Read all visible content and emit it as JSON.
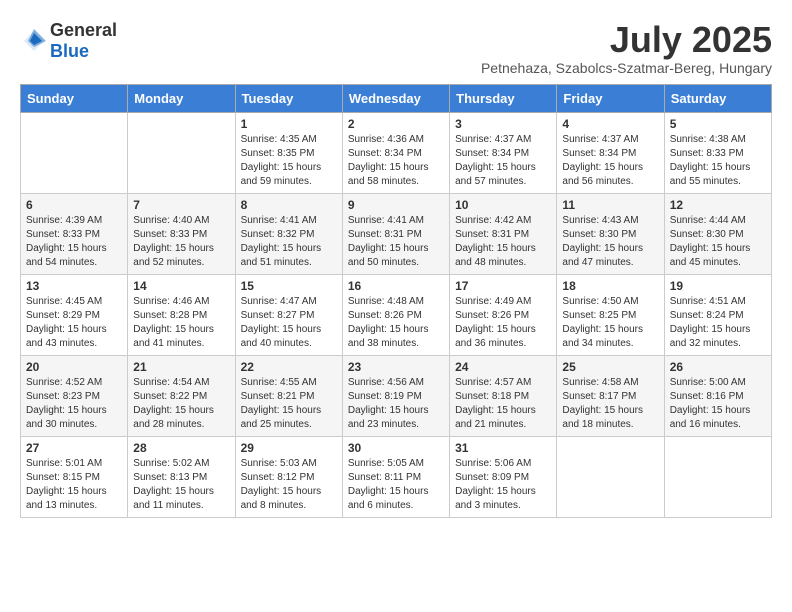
{
  "logo": {
    "general": "General",
    "blue": "Blue"
  },
  "title": "July 2025",
  "subtitle": "Petnehaza, Szabolcs-Szatmar-Bereg, Hungary",
  "days_of_week": [
    "Sunday",
    "Monday",
    "Tuesday",
    "Wednesday",
    "Thursday",
    "Friday",
    "Saturday"
  ],
  "weeks": [
    [
      {
        "day": "",
        "info": ""
      },
      {
        "day": "",
        "info": ""
      },
      {
        "day": "1",
        "info": "Sunrise: 4:35 AM\nSunset: 8:35 PM\nDaylight: 15 hours and 59 minutes."
      },
      {
        "day": "2",
        "info": "Sunrise: 4:36 AM\nSunset: 8:34 PM\nDaylight: 15 hours and 58 minutes."
      },
      {
        "day": "3",
        "info": "Sunrise: 4:37 AM\nSunset: 8:34 PM\nDaylight: 15 hours and 57 minutes."
      },
      {
        "day": "4",
        "info": "Sunrise: 4:37 AM\nSunset: 8:34 PM\nDaylight: 15 hours and 56 minutes."
      },
      {
        "day": "5",
        "info": "Sunrise: 4:38 AM\nSunset: 8:33 PM\nDaylight: 15 hours and 55 minutes."
      }
    ],
    [
      {
        "day": "6",
        "info": "Sunrise: 4:39 AM\nSunset: 8:33 PM\nDaylight: 15 hours and 54 minutes."
      },
      {
        "day": "7",
        "info": "Sunrise: 4:40 AM\nSunset: 8:33 PM\nDaylight: 15 hours and 52 minutes."
      },
      {
        "day": "8",
        "info": "Sunrise: 4:41 AM\nSunset: 8:32 PM\nDaylight: 15 hours and 51 minutes."
      },
      {
        "day": "9",
        "info": "Sunrise: 4:41 AM\nSunset: 8:31 PM\nDaylight: 15 hours and 50 minutes."
      },
      {
        "day": "10",
        "info": "Sunrise: 4:42 AM\nSunset: 8:31 PM\nDaylight: 15 hours and 48 minutes."
      },
      {
        "day": "11",
        "info": "Sunrise: 4:43 AM\nSunset: 8:30 PM\nDaylight: 15 hours and 47 minutes."
      },
      {
        "day": "12",
        "info": "Sunrise: 4:44 AM\nSunset: 8:30 PM\nDaylight: 15 hours and 45 minutes."
      }
    ],
    [
      {
        "day": "13",
        "info": "Sunrise: 4:45 AM\nSunset: 8:29 PM\nDaylight: 15 hours and 43 minutes."
      },
      {
        "day": "14",
        "info": "Sunrise: 4:46 AM\nSunset: 8:28 PM\nDaylight: 15 hours and 41 minutes."
      },
      {
        "day": "15",
        "info": "Sunrise: 4:47 AM\nSunset: 8:27 PM\nDaylight: 15 hours and 40 minutes."
      },
      {
        "day": "16",
        "info": "Sunrise: 4:48 AM\nSunset: 8:26 PM\nDaylight: 15 hours and 38 minutes."
      },
      {
        "day": "17",
        "info": "Sunrise: 4:49 AM\nSunset: 8:26 PM\nDaylight: 15 hours and 36 minutes."
      },
      {
        "day": "18",
        "info": "Sunrise: 4:50 AM\nSunset: 8:25 PM\nDaylight: 15 hours and 34 minutes."
      },
      {
        "day": "19",
        "info": "Sunrise: 4:51 AM\nSunset: 8:24 PM\nDaylight: 15 hours and 32 minutes."
      }
    ],
    [
      {
        "day": "20",
        "info": "Sunrise: 4:52 AM\nSunset: 8:23 PM\nDaylight: 15 hours and 30 minutes."
      },
      {
        "day": "21",
        "info": "Sunrise: 4:54 AM\nSunset: 8:22 PM\nDaylight: 15 hours and 28 minutes."
      },
      {
        "day": "22",
        "info": "Sunrise: 4:55 AM\nSunset: 8:21 PM\nDaylight: 15 hours and 25 minutes."
      },
      {
        "day": "23",
        "info": "Sunrise: 4:56 AM\nSunset: 8:19 PM\nDaylight: 15 hours and 23 minutes."
      },
      {
        "day": "24",
        "info": "Sunrise: 4:57 AM\nSunset: 8:18 PM\nDaylight: 15 hours and 21 minutes."
      },
      {
        "day": "25",
        "info": "Sunrise: 4:58 AM\nSunset: 8:17 PM\nDaylight: 15 hours and 18 minutes."
      },
      {
        "day": "26",
        "info": "Sunrise: 5:00 AM\nSunset: 8:16 PM\nDaylight: 15 hours and 16 minutes."
      }
    ],
    [
      {
        "day": "27",
        "info": "Sunrise: 5:01 AM\nSunset: 8:15 PM\nDaylight: 15 hours and 13 minutes."
      },
      {
        "day": "28",
        "info": "Sunrise: 5:02 AM\nSunset: 8:13 PM\nDaylight: 15 hours and 11 minutes."
      },
      {
        "day": "29",
        "info": "Sunrise: 5:03 AM\nSunset: 8:12 PM\nDaylight: 15 hours and 8 minutes."
      },
      {
        "day": "30",
        "info": "Sunrise: 5:05 AM\nSunset: 8:11 PM\nDaylight: 15 hours and 6 minutes."
      },
      {
        "day": "31",
        "info": "Sunrise: 5:06 AM\nSunset: 8:09 PM\nDaylight: 15 hours and 3 minutes."
      },
      {
        "day": "",
        "info": ""
      },
      {
        "day": "",
        "info": ""
      }
    ]
  ]
}
